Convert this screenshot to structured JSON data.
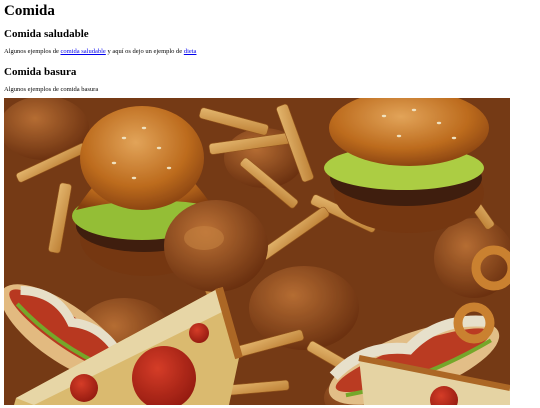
{
  "page": {
    "title": "Comida",
    "sections": [
      {
        "heading": "Comida saludable",
        "text_before": "Algunos ejemplos de ",
        "link1": "comida saludable",
        "text_middle": " y aquí os dejo un ejemplo de ",
        "link2": "dieta"
      },
      {
        "heading": "Comida basura",
        "text": "Algunos ejemplos de comida basura"
      }
    ]
  },
  "image": {
    "subject": "junk-food-photo"
  }
}
